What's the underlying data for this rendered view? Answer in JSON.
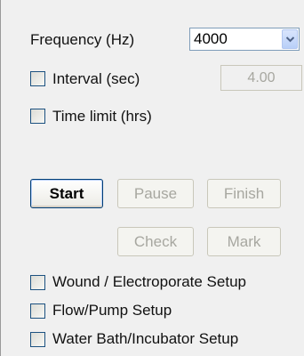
{
  "frequency": {
    "label": "Frequency (Hz)",
    "selected": "4000"
  },
  "interval": {
    "label": "Interval (sec)",
    "value": "4.00",
    "checked": false
  },
  "time_limit": {
    "label": "Time limit (hrs)",
    "checked": false
  },
  "buttons": {
    "start": "Start",
    "pause": "Pause",
    "finish": "Finish",
    "check": "Check",
    "mark": "Mark"
  },
  "setups": [
    {
      "label": "Wound / Electroporate Setup",
      "checked": false
    },
    {
      "label": "Flow/Pump Setup",
      "checked": false
    },
    {
      "label": "Water Bath/Incubator Setup",
      "checked": false
    }
  ],
  "icons": {
    "dropdown": "chevron-down-icon"
  },
  "colors": {
    "panel_bg": "#f0f0f0",
    "checkbox_border": "#1c5180",
    "disabled_text": "#a7a7a0",
    "primary_border": "#003c74"
  }
}
